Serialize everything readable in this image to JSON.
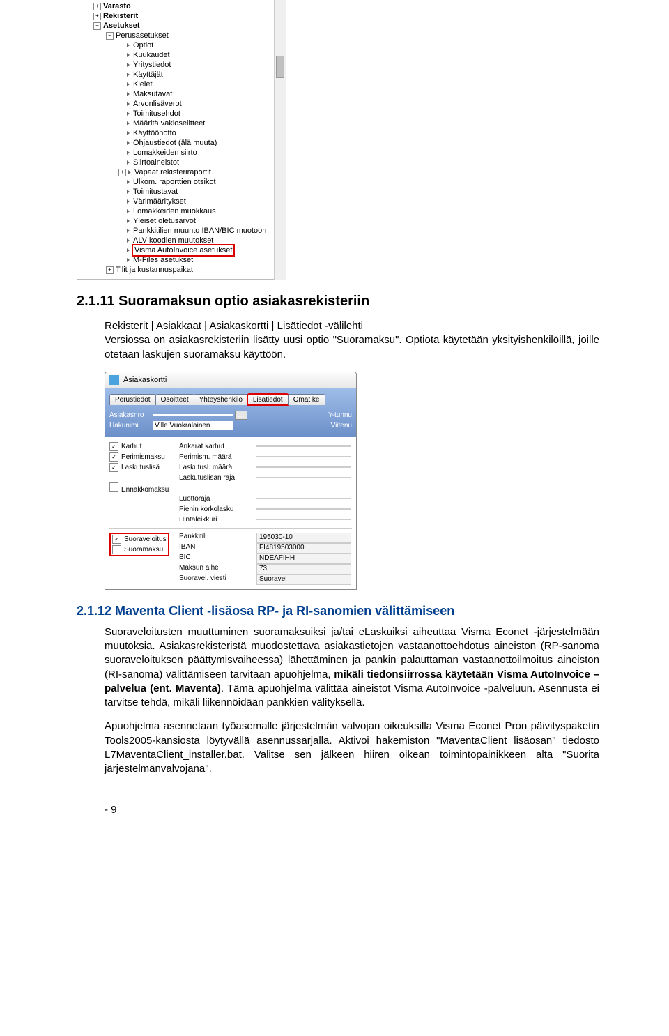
{
  "tree": {
    "top_items": [
      {
        "exp": "plus",
        "bold": true,
        "label": "Varasto"
      },
      {
        "exp": "plus",
        "bold": true,
        "label": "Rekisterit"
      },
      {
        "exp": "minus",
        "bold": true,
        "label": "Asetukset"
      }
    ],
    "perus_item": {
      "exp": "minus",
      "label": "Perusasetukset"
    },
    "children": [
      "Optiot",
      "Kuukaudet",
      "Yritystiedot",
      "Käyttäjät",
      "Kielet",
      "Maksutavat",
      "Arvonlisäverot",
      "Toimitusehdot",
      "Määritä vakioselitteet",
      "Käyttöönotto",
      "Ohjaustiedot (älä muuta)",
      "Lomakkeiden siirto",
      "Siirtoaineistot",
      "Vapaat rekisteriraportit",
      "Ulkom. raporttien otsikot",
      "Toimitustavat",
      "Värimääritykset",
      "Lomakkeiden muokkaus",
      "Yleiset oletusarvot",
      "Pankkitilien muunto IBAN/BIC muotoon",
      "ALV koodien muutokset",
      "Visma AutoInvoice asetukset",
      "M-Files asetukset"
    ],
    "vapaa_idx": 13,
    "highlight_idx": 21,
    "bottom_item": {
      "exp": "plus",
      "label": "Tilit ja kustannuspaikat"
    }
  },
  "sec211_heading": "2.1.11 Suoramaksun optio asiakasrekisteriin",
  "sec211_para": "Rekisterit | Asiakkaat | Asiakaskortti | Lisätiedot -välilehti\nVersiossa on asiakasrekisteriin lisätty uusi optio \"Suoramaksu\". Optiota käytetään yksityishenkilöillä, joille otetaan laskujen suoramaksu käyttöön.",
  "card": {
    "title": "Asiakaskortti",
    "tabs": [
      "Perustiedot",
      "Osoitteet",
      "Yhteyshenkilö",
      "Lisätiedot",
      "Omat ke"
    ],
    "highlight_tab_idx": 3,
    "rows1": [
      {
        "lbl": "Asiakasnro",
        "val": "",
        "ell": true,
        "rlabel": "Y-tunnu"
      },
      {
        "lbl": "Hakunimi",
        "val": "Ville Vuokralainen",
        "ell": false,
        "rlabel": "Viitenu"
      }
    ],
    "checks": [
      {
        "checked": true,
        "c1": "Karhut",
        "c2": "Ankarat karhut"
      },
      {
        "checked": true,
        "c1": "Perimismaksu",
        "c2": "Perimism. määrä"
      },
      {
        "checked": true,
        "c1": "Laskutuslisä",
        "c2": "Laskutusl. määrä"
      },
      {
        "checked": false,
        "c1": "",
        "c2": "Laskutuslisän raja"
      },
      {
        "checked": false,
        "c1": "Ennakkomaksu",
        "c2": ""
      }
    ],
    "extras": [
      "Luottoraja",
      "Pienin korkolasku",
      "Hintaleikkuri"
    ],
    "opts": [
      {
        "checked": true,
        "label": "Suoraveloitus"
      },
      {
        "checked": false,
        "label": "Suoramaksu"
      }
    ],
    "bank": [
      {
        "lbl": "Pankkitili",
        "val": "195030-10"
      },
      {
        "lbl": "IBAN",
        "val": "FI4819503000"
      },
      {
        "lbl": "BIC",
        "val": "NDEAFIHH"
      },
      {
        "lbl": "Maksun aihe",
        "val": "73"
      },
      {
        "lbl": "Suoravel. viesti",
        "val": "Suoravel"
      }
    ]
  },
  "sec212_heading": "2.1.12 Maventa Client -lisäosa RP- ja RI-sanomien välittämiseen",
  "sec212_p1": "Suoraveloitusten muuttuminen suoramaksuiksi ja/tai eLaskuiksi aiheuttaa Visma Econet -järjestelmään muutoksia. Asiakasrekisteristä muodostettava asiakastietojen vastaanottoehdotus aineiston (RP-sanoma suoraveloituksen päättymisvaiheessa) lähettäminen ja pankin palauttaman vastaanottoilmoitus aineiston (RI-sanoma) välittämiseen tarvitaan apuohjelma, ",
  "sec212_bold": "mikäli tiedonsiirrossa käytetään Visma AutoInvoice –palvelua (ent. Maventa)",
  "sec212_p1b": ". Tämä apuohjelma välittää aineistot Visma AutoInvoice -palveluun. Asennusta ei tarvitse tehdä, mikäli liikennöidään pankkien välityksellä.",
  "sec212_p2": "Apuohjelma asennetaan työasemalle järjestelmän valvojan oikeuksilla Visma Econet Pron päivityspaketin Tools2005-kansiosta löytyvällä asennussarjalla. Aktivoi hakemiston \"MaventaClient lisäosan\" tiedosto L7MaventaClient_installer.bat. Valitse sen jälkeen hiiren oikean toimintopainikkeen alta \"Suorita järjestelmänvalvojana\".",
  "footer": "- 9"
}
